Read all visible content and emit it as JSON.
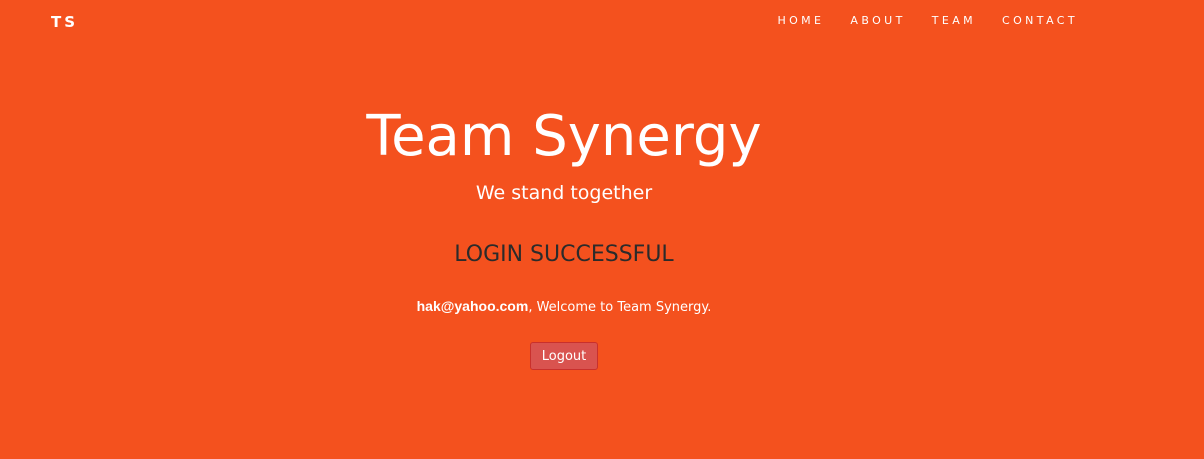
{
  "navbar": {
    "brand": "TS",
    "links": [
      "HOME",
      "ABOUT",
      "TEAM",
      "CONTACT"
    ]
  },
  "hero": {
    "title": "Team Synergy",
    "subtitle": "We stand together",
    "status": "LOGIN SUCCESSFUL",
    "user_email": "hak@yahoo.com",
    "welcome_text": ", Welcome to Team Synergy.",
    "logout_label": "Logout"
  },
  "colors": {
    "background": "#f4511e",
    "logout_button": "#d9534f",
    "status_text": "#2b2b2b"
  }
}
